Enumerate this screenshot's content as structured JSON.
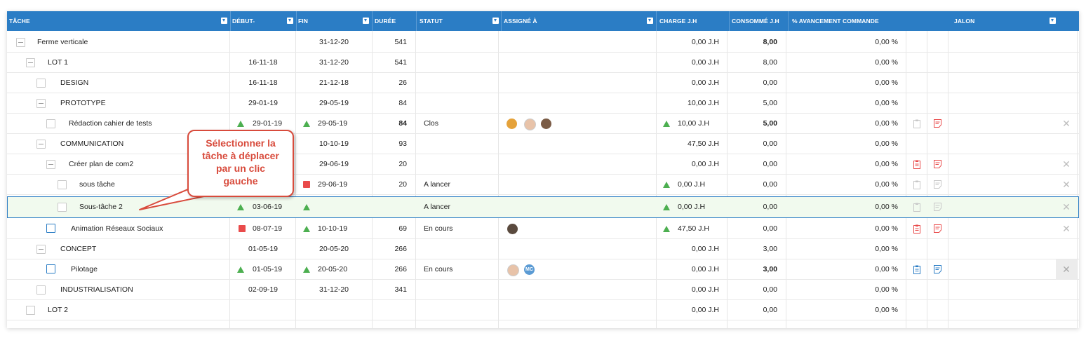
{
  "columns": {
    "tache": "TÂCHE",
    "debut": "DÉBUT-",
    "fin": "FIN",
    "duree": "DURÉE",
    "statut": "STATUT",
    "assigne": "ASSIGNÉ À",
    "charge": "CHARGE J.H",
    "consomme": "CONSOMMÉ J.H",
    "avancement": "% AVANCEMENT COMMANDE",
    "jalon": "JALON"
  },
  "rows": [
    {
      "name": "Ferme verticale",
      "debut": "",
      "fin": "31-12-20",
      "duree": "541",
      "statut": "",
      "charge": "0,00 J.H",
      "consomme": "8,00",
      "avancement": "0,00 %"
    },
    {
      "name": "LOT 1",
      "debut": "16-11-18",
      "fin": "31-12-20",
      "duree": "541",
      "statut": "",
      "charge": "0,00 J.H",
      "consomme": "8,00",
      "avancement": "0,00 %"
    },
    {
      "name": "DESIGN",
      "debut": "16-11-18",
      "fin": "21-12-18",
      "duree": "26",
      "statut": "",
      "charge": "0,00 J.H",
      "consomme": "0,00",
      "avancement": "0,00 %"
    },
    {
      "name": "PROTOTYPE",
      "debut": "29-01-19",
      "fin": "29-05-19",
      "duree": "84",
      "statut": "",
      "charge": "10,00 J.H",
      "consomme": "5,00",
      "avancement": "0,00 %"
    },
    {
      "name": "Rédaction cahier de tests",
      "debut": "29-01-19",
      "fin": "29-05-19",
      "duree": "84",
      "statut": "Clos",
      "charge": "10,00 J.H",
      "consomme": "5,00",
      "avancement": "0,00 %"
    },
    {
      "name": "COMMUNICATION",
      "debut": "",
      "fin": "10-10-19",
      "duree": "93",
      "statut": "",
      "charge": "47,50 J.H",
      "consomme": "0,00",
      "avancement": "0,00 %"
    },
    {
      "name": "Créer plan de com2",
      "debut": "",
      "fin": "29-06-19",
      "duree": "20",
      "statut": "",
      "charge": "0,00 J.H",
      "consomme": "0,00",
      "avancement": "0,00 %"
    },
    {
      "name": "sous tâche",
      "debut": "",
      "fin": "29-06-19",
      "duree": "20",
      "statut": "A lancer",
      "charge": "0,00 J.H",
      "consomme": "0,00",
      "avancement": "0,00 %"
    },
    {
      "name": "Sous-tâche 2",
      "debut": "03-06-19",
      "fin": "",
      "duree": "",
      "statut": "A lancer",
      "charge": "0,00 J.H",
      "consomme": "0,00",
      "avancement": "0,00 %"
    },
    {
      "name": "Animation Réseaux Sociaux",
      "debut": "08-07-19",
      "fin": "10-10-19",
      "duree": "69",
      "statut": "En cours",
      "charge": "47,50 J.H",
      "consomme": "0,00",
      "avancement": "0,00 %"
    },
    {
      "name": "CONCEPT",
      "debut": "01-05-19",
      "fin": "20-05-20",
      "duree": "266",
      "statut": "",
      "charge": "0,00 J.H",
      "consomme": "3,00",
      "avancement": "0,00 %"
    },
    {
      "name": "Pilotage",
      "debut": "01-05-19",
      "fin": "20-05-20",
      "duree": "266",
      "statut": "En cours",
      "charge": "0,00 J.H",
      "consomme": "3,00",
      "avancement": "0,00 %"
    },
    {
      "name": "INDUSTRIALISATION",
      "debut": "02-09-19",
      "fin": "31-12-20",
      "duree": "341",
      "statut": "",
      "charge": "0,00 J.H",
      "consomme": "0,00",
      "avancement": "0,00 %"
    },
    {
      "name": "LOT 2",
      "debut": "",
      "fin": "",
      "duree": "",
      "statut": "",
      "charge": "0,00 J.H",
      "consomme": "0,00",
      "avancement": "0,00 %"
    }
  ],
  "avatars": {
    "mc_initials": "MC"
  },
  "callout": {
    "line1": "Sélectionner la",
    "line2": "tâche à déplacer",
    "line3": "par un clic",
    "line4": "gauche"
  },
  "colors": {
    "header": "#2b7dc5",
    "selected_row": "#f1faee",
    "on_time": "#4caf50",
    "late": "#e94b4b",
    "callout": "#d84b3c"
  }
}
